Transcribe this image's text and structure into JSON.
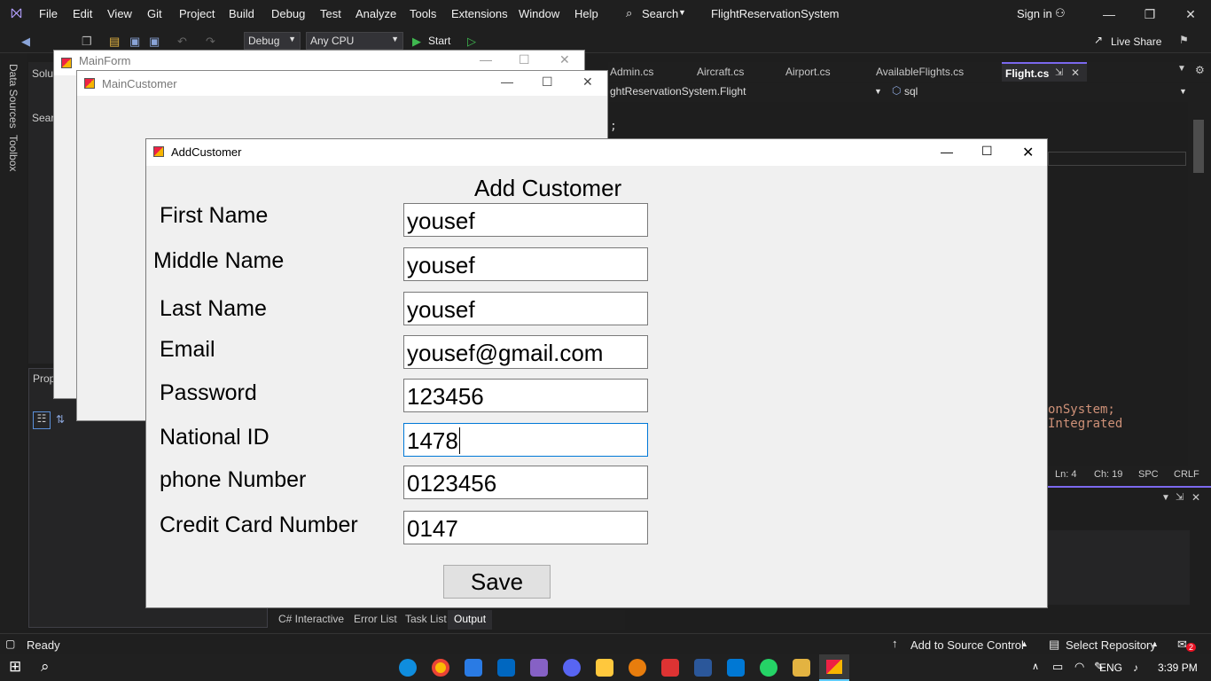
{
  "vs": {
    "menu": [
      "File",
      "Edit",
      "View",
      "Git",
      "Project",
      "Build",
      "Debug",
      "Test",
      "Analyze",
      "Tools",
      "Extensions",
      "Window",
      "Help"
    ],
    "search_label": "Search",
    "solution_name": "FlightReservationSystem",
    "sign_in": "Sign in",
    "live_share": "Live Share",
    "config": "Debug",
    "platform": "Any CPU",
    "start_label": "Start",
    "left_rail": [
      "Data Sources",
      "Toolbox"
    ],
    "sol_label": "Solu",
    "search_label_short": "Sear",
    "prop_label": "Prop",
    "doc_tabs": [
      "Admin.cs",
      "Aircraft.cs",
      "Airport.cs",
      "AvailableFlights.cs",
      "Flight.cs"
    ],
    "nav_class": "ghtReservationSystem.Flight",
    "nav_member": "sql",
    "code_fragment": ";",
    "code_fragment2": "onSystem; Integrated",
    "status_line": "Ln: 4",
    "status_char": "Ch: 19",
    "status_spc": "SPC",
    "status_crlf": "CRLF",
    "bottom_tabs": [
      "C# Interactive",
      "Error List",
      "Task List",
      "Output"
    ],
    "ready": "Ready",
    "add_source": "Add to Source Control",
    "select_repo": "Select Repository",
    "notifications": "2"
  },
  "taskbar": {
    "lang": "ENG",
    "time": "3:39 PM"
  },
  "main_form": {
    "title": "MainForm"
  },
  "main_customer": {
    "title": "MainCustomer"
  },
  "add_customer": {
    "title": "AddCustomer",
    "heading": "Add Customer",
    "fields": [
      {
        "label": "First Name",
        "value": "yousef"
      },
      {
        "label": "Middle Name",
        "value": "yousef"
      },
      {
        "label": "Last Name",
        "value": "yousef"
      },
      {
        "label": "Email",
        "value": "yousef@gmail.com"
      },
      {
        "label": "Password",
        "value": "123456"
      },
      {
        "label": "National ID",
        "value": "1478"
      },
      {
        "label": "phone Number",
        "value": "0123456"
      },
      {
        "label": "Credit Card Number",
        "value": "0147"
      }
    ],
    "save_label": "Save"
  },
  "colors": {
    "accent": "#0078d7",
    "vs_purple": "#7b68ee"
  }
}
